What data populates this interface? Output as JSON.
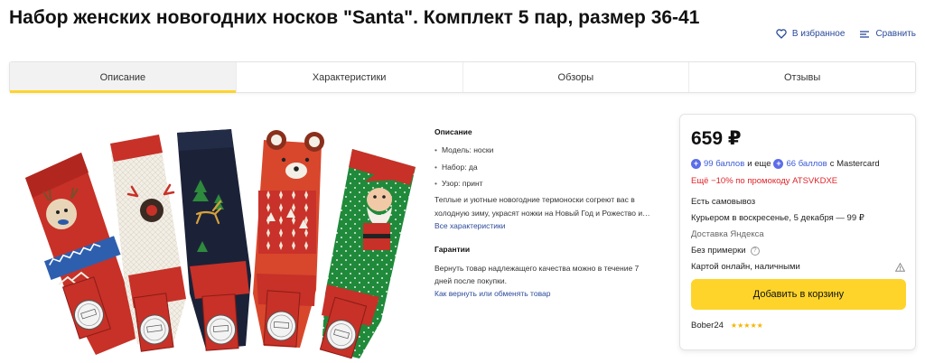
{
  "product": {
    "title": "Набор женских новогодних носков \"Santa\". Комплект 5 пар, размер 36-41"
  },
  "actions": {
    "favorite_label": "В избранное",
    "compare_label": "Сравнить"
  },
  "tabs": [
    {
      "label": "Описание",
      "active": true
    },
    {
      "label": "Характеристики",
      "active": false
    },
    {
      "label": "Обзоры",
      "active": false
    },
    {
      "label": "Отзывы",
      "active": false
    }
  ],
  "description": {
    "heading": "Описание",
    "specs": [
      "Модель: носки",
      "Набор: да",
      "Узор: принт"
    ],
    "text_line1": "Теплые и уютные новогодние термоноски согреют вас в",
    "text_line2": "холодную зиму, украсят ножки на Новый Год и Рожество и…",
    "all_specs_link": "Все характеристики"
  },
  "guarantee": {
    "heading": "Гарантии",
    "text_line1": "Вернуть товар надлежащего качества можно в течение 7",
    "text_line2": "дней после покупки.",
    "return_link": "Как вернуть или обменять товар"
  },
  "offer": {
    "price": "659 ₽",
    "bonus_points": "99 баллов",
    "bonus_and": "и еще",
    "bonus_mc_points": "66 баллов",
    "bonus_mc_suffix": "с Mastercard",
    "promo": "Ещё −10% по промокоду ATSVKDXE",
    "pickup": "Есть самовывоз",
    "courier": "Курьером в воскресенье, 5 декабря — 99 ₽",
    "delivery_provider": "Доставка Яндекса",
    "no_fitting": "Без примерки",
    "payment": "Картой онлайн, наличными",
    "add_to_cart": "Добавить в корзину",
    "seller_name": "Bober24",
    "seller_rating_stars": 5
  },
  "colors": {
    "accent_yellow": "#fed42b",
    "link_blue": "#2a4a9a",
    "promo_red": "#e0242a",
    "bonus_blue": "#3a5bd5"
  }
}
